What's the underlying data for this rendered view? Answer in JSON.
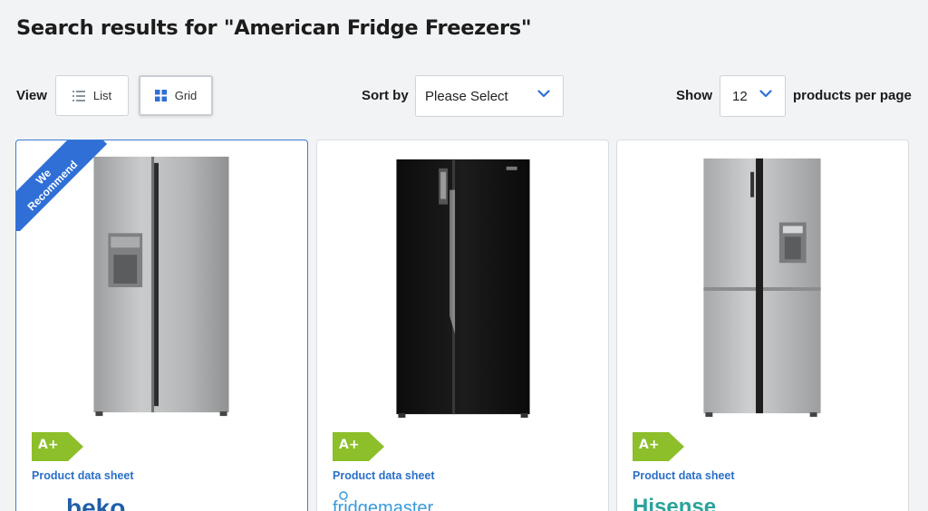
{
  "page": {
    "title": "Search results for \"American Fridge Freezers\""
  },
  "toolbar": {
    "view_label": "View",
    "list_label": "List",
    "grid_label": "Grid",
    "sort_label": "Sort by",
    "sort_value": "Please Select",
    "show_label": "Show",
    "show_value": "12",
    "per_page_label": "products per page"
  },
  "colors": {
    "accent": "#2f6fd6",
    "energy_green": "#8cbf2a",
    "link": "#2a6fc9"
  },
  "products": [
    {
      "badge": [
        "We",
        "Recommend"
      ],
      "energy_rating": "A+",
      "datasheet_label": "Product data sheet",
      "brand": "beko",
      "finish": "silver",
      "door_style": "side-by-side",
      "water_dispenser": true
    },
    {
      "energy_rating": "A+",
      "datasheet_label": "Product data sheet",
      "brand": "fridgemaster",
      "finish": "black",
      "door_style": "side-by-side",
      "water_dispenser": false
    },
    {
      "energy_rating": "A+",
      "datasheet_label": "Product data sheet",
      "brand": "Hisense",
      "finish": "silver",
      "door_style": "four-door",
      "water_dispenser": true
    }
  ]
}
